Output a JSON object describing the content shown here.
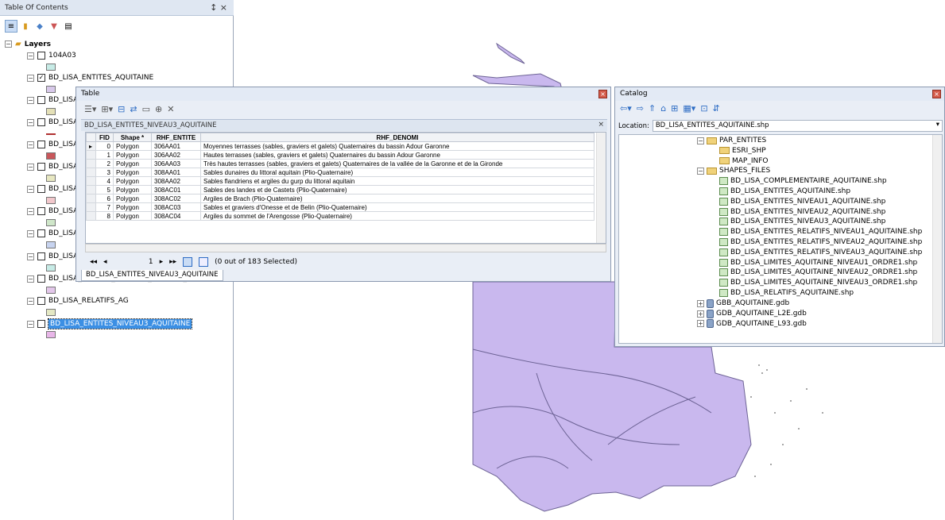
{
  "toc": {
    "title": "Table Of Contents",
    "pin": "↕ ×",
    "layers_label": "Layers",
    "items": [
      {
        "label": "104A03",
        "checked": false,
        "swatch": "#c7ebe6"
      },
      {
        "label": "BD_LISA_ENTITES_AQUITAINE",
        "checked": true,
        "swatch": "#d8c9ea"
      },
      {
        "label": "BD_LISA",
        "checked": false,
        "swatch": "#e4e0b7"
      },
      {
        "label": "BD_LISA",
        "checked": false,
        "swatch": "#b03030"
      },
      {
        "label": "BD_LISA",
        "checked": false,
        "swatch": "#c9575b"
      },
      {
        "label": "BD_LISA",
        "checked": false,
        "swatch": "#e7e7c1"
      },
      {
        "label": "BD_LISA",
        "checked": false,
        "swatch": "#f2c8cc"
      },
      {
        "label": "BD_LISA",
        "checked": false,
        "swatch": "#cfe6c9"
      },
      {
        "label": "BD_LISA",
        "checked": false,
        "swatch": "#c7d3ef"
      },
      {
        "label": "BD_LISA",
        "checked": false,
        "swatch": "#c7ebe6"
      },
      {
        "label": "BD_LISA_ENTITES_RELATIFS_NIVEAU3_AG",
        "checked": false,
        "swatch": "#e3c7ea"
      },
      {
        "label": "BD_LISA_RELATIFS_AG",
        "checked": false,
        "swatch": "#e4e8c4"
      },
      {
        "label": "BD_LISA_ENTITES_NIVEAU3_AQUITAINE",
        "checked": false,
        "swatch": "#e8b6e8"
      }
    ]
  },
  "table": {
    "title": "Table",
    "name": "BD_LISA_ENTITES_NIVEAU3_AQUITAINE",
    "columns": [
      "FID",
      "Shape *",
      "RHF_ENTITE",
      "RHF_DENOMI"
    ],
    "rows": [
      [
        "0",
        "Polygon",
        "306AA01",
        "Moyennes terrasses (sables, graviers et galets) Quaternaires du bassin Adour Garonne"
      ],
      [
        "1",
        "Polygon",
        "306AA02",
        "Hautes terrasses (sables, graviers et galets) Quaternaires du bassin Adour Garonne"
      ],
      [
        "2",
        "Polygon",
        "306AA03",
        "Très hautes terrasses (sables, graviers et galets) Quaternaires de la vallée de la Garonne et de la Gironde"
      ],
      [
        "3",
        "Polygon",
        "308AA01",
        "Sables dunaires du littoral aquitain (Plio-Quaternaire)"
      ],
      [
        "4",
        "Polygon",
        "308AA02",
        "Sables flandriens et argiles du gurp du littoral aquitain"
      ],
      [
        "5",
        "Polygon",
        "308AC01",
        "Sables des landes et de Castets (Plio-Quaternaire)"
      ],
      [
        "6",
        "Polygon",
        "308AC02",
        "Argiles de Brach (Plio-Quaternaire)"
      ],
      [
        "7",
        "Polygon",
        "308AC03",
        "Sables et graviers d'Onesse et de Belin (Plio-Quaternaire)"
      ],
      [
        "8",
        "Polygon",
        "308AC04",
        "Argiles du sommet de l'Arengosse (Plio-Quaternaire)"
      ]
    ],
    "record": "1",
    "selection": "(0 out of 183 Selected)",
    "tab": "BD_LISA_ENTITES_NIVEAU3_AQUITAINE"
  },
  "catalog": {
    "title": "Catalog",
    "location_label": "Location:",
    "location_value": "BD_LISA_ENTITES_AQUITAINE.shp",
    "tree": [
      {
        "label": "PAR_ENTITES",
        "kind": "folder",
        "level": 0,
        "exp": "⊟"
      },
      {
        "label": "ESRI_SHP",
        "kind": "folder",
        "level": 1
      },
      {
        "label": "MAP_INFO",
        "kind": "folder",
        "level": 1
      },
      {
        "label": "SHAPES_FILES",
        "kind": "folder",
        "level": 0,
        "exp": "⊟"
      },
      {
        "label": "BD_LISA_COMPLEMENTAIRE_AQUITAINE.shp",
        "kind": "shp",
        "level": 1
      },
      {
        "label": "BD_LISA_ENTITES_AQUITAINE.shp",
        "kind": "shp",
        "level": 1
      },
      {
        "label": "BD_LISA_ENTITES_NIVEAU1_AQUITAINE.shp",
        "kind": "shp",
        "level": 1
      },
      {
        "label": "BD_LISA_ENTITES_NIVEAU2_AQUITAINE.shp",
        "kind": "shp",
        "level": 1
      },
      {
        "label": "BD_LISA_ENTITES_NIVEAU3_AQUITAINE.shp",
        "kind": "shp",
        "level": 1
      },
      {
        "label": "BD_LISA_ENTITES_RELATIFS_NIVEAU1_AQUITAINE.shp",
        "kind": "shp",
        "level": 1
      },
      {
        "label": "BD_LISA_ENTITES_RELATIFS_NIVEAU2_AQUITAINE.shp",
        "kind": "shp",
        "level": 1
      },
      {
        "label": "BD_LISA_ENTITES_RELATIFS_NIVEAU3_AQUITAINE.shp",
        "kind": "shp",
        "level": 1
      },
      {
        "label": "BD_LISA_LIMITES_AQUITAINE_NIVEAU1_ORDRE1.shp",
        "kind": "shp",
        "level": 1
      },
      {
        "label": "BD_LISA_LIMITES_AQUITAINE_NIVEAU2_ORDRE1.shp",
        "kind": "shp",
        "level": 1
      },
      {
        "label": "BD_LISA_LIMITES_AQUITAINE_NIVEAU3_ORDRE1.shp",
        "kind": "shp",
        "level": 1
      },
      {
        "label": "BD_LISA_RELATIFS_AQUITAINE.shp",
        "kind": "shp",
        "level": 1
      },
      {
        "label": "GBB_AQUITAINE.gdb",
        "kind": "gdb",
        "level": -1,
        "exp": "⊞"
      },
      {
        "label": "GDB_AQUITAINE_L2E.gdb",
        "kind": "gdb",
        "level": -1,
        "exp": "⊞"
      },
      {
        "label": "GDB_AQUITAINE_L93.gdb",
        "kind": "gdb",
        "level": -1,
        "exp": "⊞"
      }
    ]
  },
  "map": {
    "fill": "#c9b8ee",
    "stroke": "#6d6395"
  }
}
